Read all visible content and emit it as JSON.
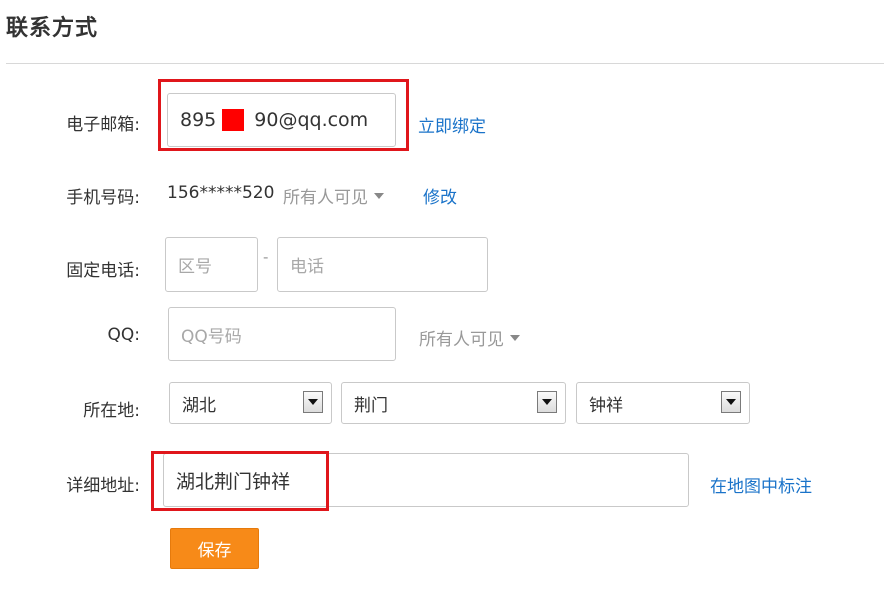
{
  "section": {
    "title": "联系方式"
  },
  "email": {
    "label": "电子邮箱:",
    "value_prefix": "895",
    "value_suffix": "90@qq.com",
    "bind_link": "立即绑定"
  },
  "mobile": {
    "label": "手机号码:",
    "value": "156*****520",
    "visibility": "所有人可见",
    "edit_link": "修改"
  },
  "phone": {
    "label": "固定电话:",
    "area_placeholder": "区号",
    "separator": "-",
    "number_placeholder": "电话"
  },
  "qq": {
    "label": "QQ:",
    "placeholder": "QQ号码",
    "visibility": "所有人可见"
  },
  "location": {
    "label": "所在地:",
    "province": "湖北",
    "city": "荆门",
    "district": "钟祥"
  },
  "address": {
    "label": "详细地址:",
    "value": "湖北荆门钟祥",
    "map_link": "在地图中标注"
  },
  "save_label": "保存",
  "colors": {
    "link": "#1a73c9",
    "save_button": "#f78a18",
    "highlight_box": "#e0161b"
  }
}
